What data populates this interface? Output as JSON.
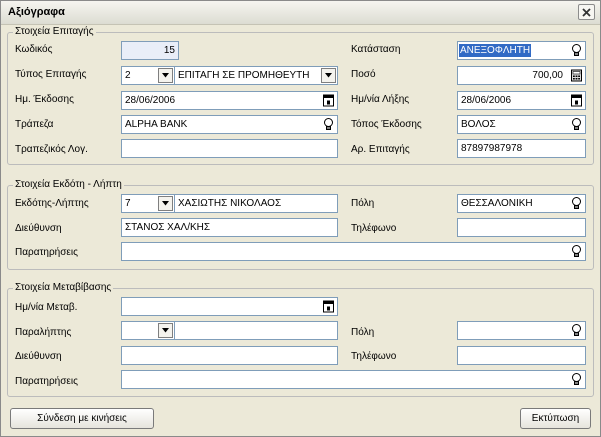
{
  "window": {
    "title": "Αξιόγραφα"
  },
  "cheque": {
    "legend": "Στοιχεία Επιταγής",
    "code_label": "Κωδικός",
    "code_value": "15",
    "type_label": "Τύπος Επιταγής",
    "type_code": "2",
    "type_desc": "ΕΠΙΤΑΓΗ ΣΕ ΠΡΟΜΗΘΕΥΤΗ",
    "issue_date_label": "Ημ. Έκδοσης",
    "issue_date_value": "28/06/2006",
    "bank_label": "Τράπεζα",
    "bank_value": "ALPHA BANK",
    "bank_account_label": "Τραπεζικός Λογ.",
    "bank_account_value": "",
    "status_label": "Κατάσταση",
    "status_value": "ΑΝΕΞΟΦΛΗΤΗ",
    "amount_label": "Ποσό",
    "amount_value": "700,00",
    "due_date_label": "Ημ/νία Λήξης",
    "due_date_value": "28/06/2006",
    "issue_place_label": "Τόπος Έκδοσης",
    "issue_place_value": "ΒΟΛΟΣ",
    "cheque_no_label": "Αρ. Επιταγής",
    "cheque_no_value": "87897987978"
  },
  "issuer": {
    "legend": "Στοιχεία Εκδότη - Λήπτη",
    "party_label": "Εκδότης-Λήπτης",
    "party_code": "7",
    "party_name": "ΧΑΣΙΩΤΗΣ ΝΙΚΟΛΑΟΣ",
    "address_label": "Διεύθυνση",
    "address_value": "ΣΤΑΝΟΣ ΧΑΛ/ΚΗΣ",
    "notes_label": "Παρατηρήσεις",
    "notes_value": "",
    "city_label": "Πόλη",
    "city_value": "ΘΕΣΣΑΛΟΝΙΚΗ",
    "phone_label": "Τηλέφωνο",
    "phone_value": ""
  },
  "transfer": {
    "legend": "Στοιχεία Μεταβίβασης",
    "date_label": "Ημ/νία Μεταβ.",
    "date_value": "",
    "receiver_label": "Παραλήπτης",
    "receiver_code": "",
    "receiver_name": "",
    "address_label": "Διεύθυνση",
    "address_value": "",
    "notes_label": "Παρατηρήσεις",
    "notes_value": "",
    "city_label": "Πόλη",
    "city_value": "",
    "phone_label": "Τηλέφωνο",
    "phone_value": ""
  },
  "buttons": {
    "link_movements": "Σύνδεση με κινήσεις",
    "print": "Εκτύπωση"
  },
  "icons": {
    "lookup": "lightbulb-icon",
    "calendar": "calendar-icon",
    "calculator": "calculator-icon",
    "dropdown": "chevron-down-icon",
    "close": "close-icon"
  },
  "colors": {
    "selection": "#316ac5",
    "field_border": "#7f9db9",
    "readonly_field": "#e9eef8",
    "window_bg": "#ece9d8"
  }
}
